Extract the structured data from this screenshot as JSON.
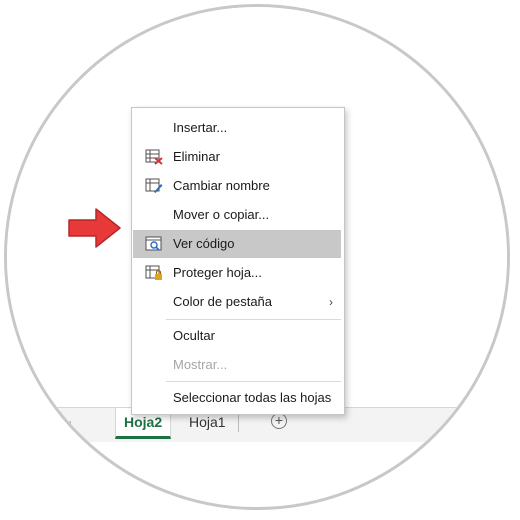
{
  "tabs": {
    "active": "Hoja2",
    "other": "Hoja1",
    "add_sheet_glyph": "+"
  },
  "menu": {
    "items": [
      {
        "label": "Insertar...",
        "icon": "insert-icon"
      },
      {
        "label": "Eliminar",
        "icon": "delete-sheet-icon"
      },
      {
        "label": "Cambiar nombre",
        "icon": "rename-sheet-icon"
      },
      {
        "label": "Mover o copiar...",
        "icon": null
      },
      {
        "label": "Ver código",
        "icon": "view-code-icon",
        "highlighted": true
      },
      {
        "label": "Proteger hoja...",
        "icon": "protect-sheet-icon"
      },
      {
        "label": "Color de pestaña",
        "icon": null,
        "submenu": true
      },
      {
        "label": "Ocultar",
        "icon": null
      },
      {
        "label": "Mostrar...",
        "icon": null,
        "disabled": true
      },
      {
        "label": "Seleccionar todas las hojas",
        "icon": null
      }
    ]
  },
  "colors": {
    "accent_green": "#1e7145",
    "pointer_red": "#e8393a",
    "highlight": "#c8c8c8"
  }
}
